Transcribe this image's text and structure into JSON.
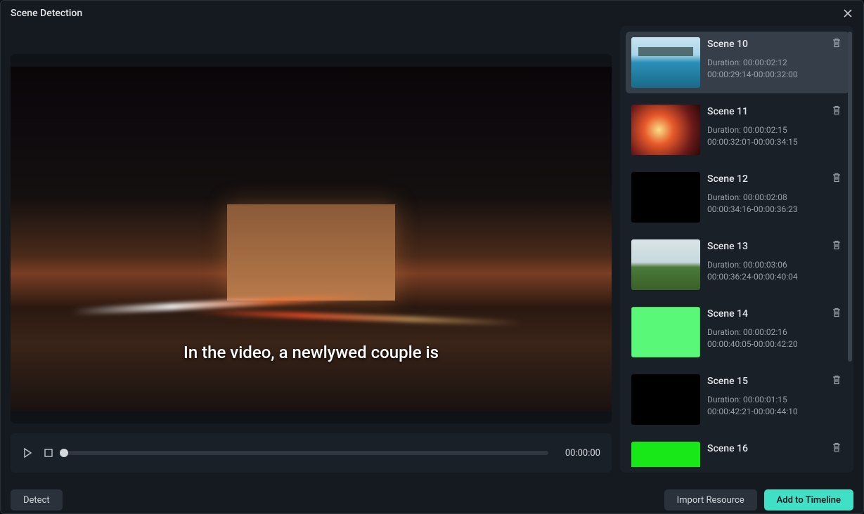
{
  "window": {
    "title": "Scene Detection"
  },
  "preview": {
    "subtitle": "In the video, a newlywed couple is"
  },
  "playback": {
    "time": "00:00:00"
  },
  "scenes": [
    {
      "name": "Scene 10",
      "duration": "Duration: 00:00:02:12",
      "range": "00:00:29:14-00:00:32:00",
      "thumb": "pool",
      "selected": true
    },
    {
      "name": "Scene 11",
      "duration": "Duration: 00:00:02:15",
      "range": "00:00:32:01-00:00:34:15",
      "thumb": "fire",
      "selected": false
    },
    {
      "name": "Scene 12",
      "duration": "Duration: 00:00:02:08",
      "range": "00:00:34:16-00:00:36:23",
      "thumb": "black",
      "selected": false
    },
    {
      "name": "Scene 13",
      "duration": "Duration: 00:00:03:06",
      "range": "00:00:36:24-00:00:40:04",
      "thumb": "field",
      "selected": false
    },
    {
      "name": "Scene 14",
      "duration": "Duration: 00:00:02:16",
      "range": "00:00:40:05-00:00:42:20",
      "thumb": "greenscreen",
      "selected": false
    },
    {
      "name": "Scene 15",
      "duration": "Duration: 00:00:01:15",
      "range": "00:00:42:21-00:00:44:10",
      "thumb": "black",
      "selected": false
    },
    {
      "name": "Scene 16",
      "duration": "",
      "range": "",
      "thumb": "green-bright",
      "selected": false
    }
  ],
  "buttons": {
    "detect": "Detect",
    "import_resource": "Import Resource",
    "add_to_timeline": "Add to Timeline"
  }
}
